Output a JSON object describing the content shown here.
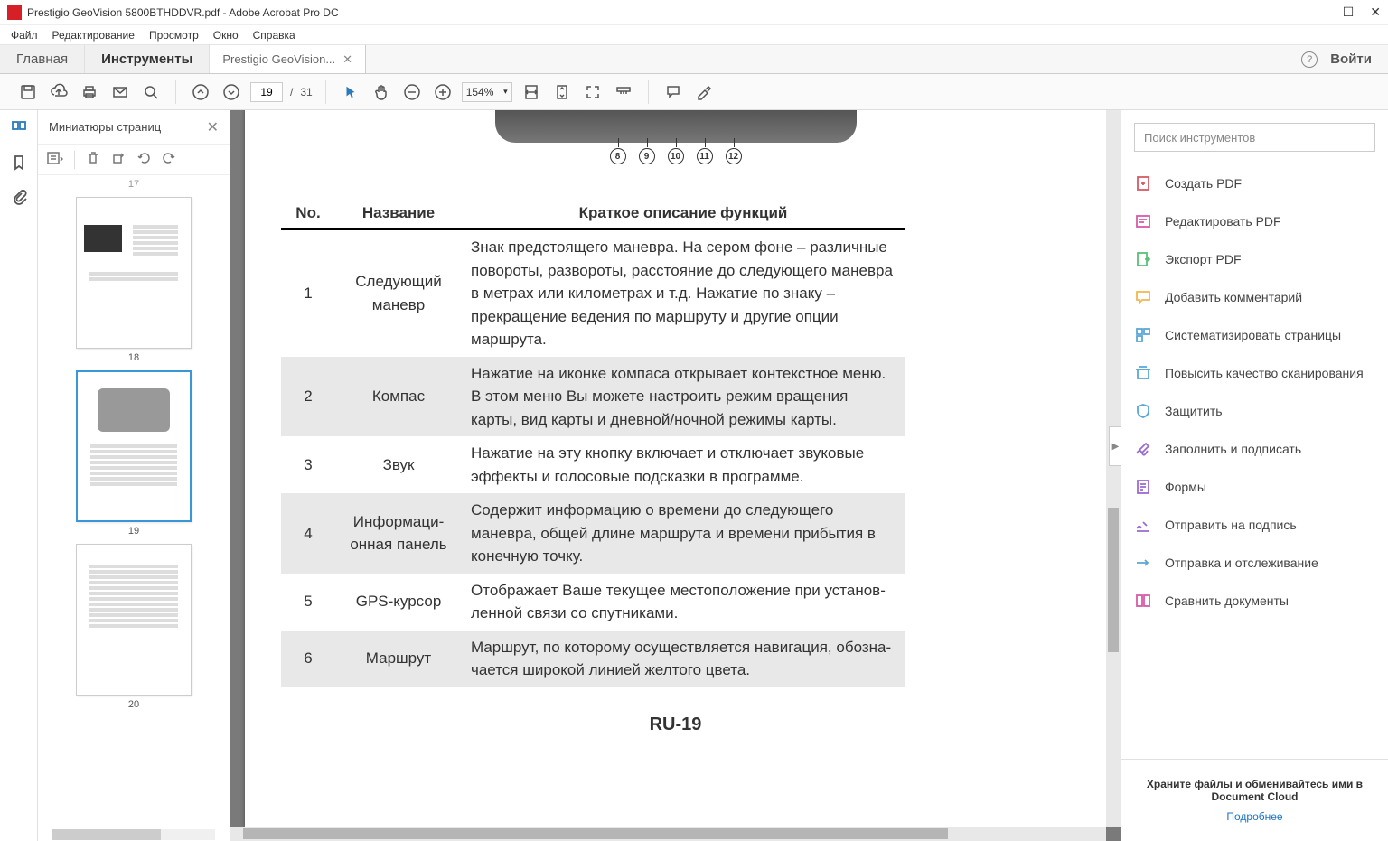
{
  "window": {
    "title": "Prestigio GeoVision 5800BTHDDVR.pdf - Adobe Acrobat Pro DC",
    "minimize": "—",
    "maximize": "☐",
    "close": "✕"
  },
  "menubar": [
    "Файл",
    "Редактирование",
    "Просмотр",
    "Окно",
    "Справка"
  ],
  "tabs": {
    "home": "Главная",
    "tools": "Инструменты",
    "doc": "Prestigio GeoVision...",
    "signin": "Войти"
  },
  "toolbar": {
    "page_current": "19",
    "page_sep": "/",
    "page_total": "31",
    "zoom": "154%"
  },
  "thumbnails": {
    "title": "Миниатюры страниц",
    "prev_label_top": "17",
    "pages": [
      {
        "num": "18",
        "selected": false
      },
      {
        "num": "19",
        "selected": true
      },
      {
        "num": "20",
        "selected": false
      }
    ]
  },
  "document": {
    "callouts": [
      "8",
      "9",
      "10",
      "11",
      "12"
    ],
    "headers": {
      "no": "No.",
      "name": "Название",
      "desc": "Краткое описание функций"
    },
    "rows": [
      {
        "no": "1",
        "name": "Следующий маневр",
        "desc": "Знак предстоящего маневра. На сером фоне – различные повороты, развороты, расстояние до следующего маневра в метрах или километрах и т.д. Нажатие по знаку – прекращение ведения по маршруту и другие опции маршрута."
      },
      {
        "no": "2",
        "name": "Компас",
        "desc": "Нажатие на иконке компаса открывает контекстное меню. В этом меню Вы можете настроить режим вращения карты, вид карты и дневной/ночной режимы карты."
      },
      {
        "no": "3",
        "name": "Звук",
        "desc": "Нажатие на эту кнопку включает и отключает звуковые эффекты и голосовые подсказки в программе."
      },
      {
        "no": "4",
        "name": "Информаци- онная панель",
        "desc": "Содержит информацию о времени до следующего маневра, общей длине маршрута и времени прибытия в конечную точку."
      },
      {
        "no": "5",
        "name": "GPS-курсор",
        "desc": "Отображает Ваше текущее местоположение при установ- ленной связи со спутниками."
      },
      {
        "no": "6",
        "name": "Маршрут",
        "desc": "Маршрут, по которому осуществляется навигация, обозна- чается широкой линией желтого цвета."
      }
    ],
    "footer": "RU-19"
  },
  "rightpanel": {
    "search_placeholder": "Поиск инструментов",
    "tools": [
      {
        "label": "Создать PDF",
        "color": "#d85a66"
      },
      {
        "label": "Редактировать PDF",
        "color": "#d85aa8"
      },
      {
        "label": "Экспорт PDF",
        "color": "#5bbf77"
      },
      {
        "label": "Добавить комментарий",
        "color": "#f0b84a"
      },
      {
        "label": "Систематизировать страницы",
        "color": "#5aa8d8"
      },
      {
        "label": "Повысить качество сканирования",
        "color": "#5aa8d8"
      },
      {
        "label": "Защитить",
        "color": "#5aa8d8"
      },
      {
        "label": "Заполнить и подписать",
        "color": "#9a6bd1"
      },
      {
        "label": "Формы",
        "color": "#9a6bd1"
      },
      {
        "label": "Отправить на подпись",
        "color": "#9a6bd1"
      },
      {
        "label": "Отправка и отслеживание",
        "color": "#5aa8d8"
      },
      {
        "label": "Сравнить документы",
        "color": "#d85aa8"
      }
    ],
    "footer_text": "Храните файлы и обменивайтесь ими в Document Cloud",
    "footer_link": "Подробнее"
  }
}
